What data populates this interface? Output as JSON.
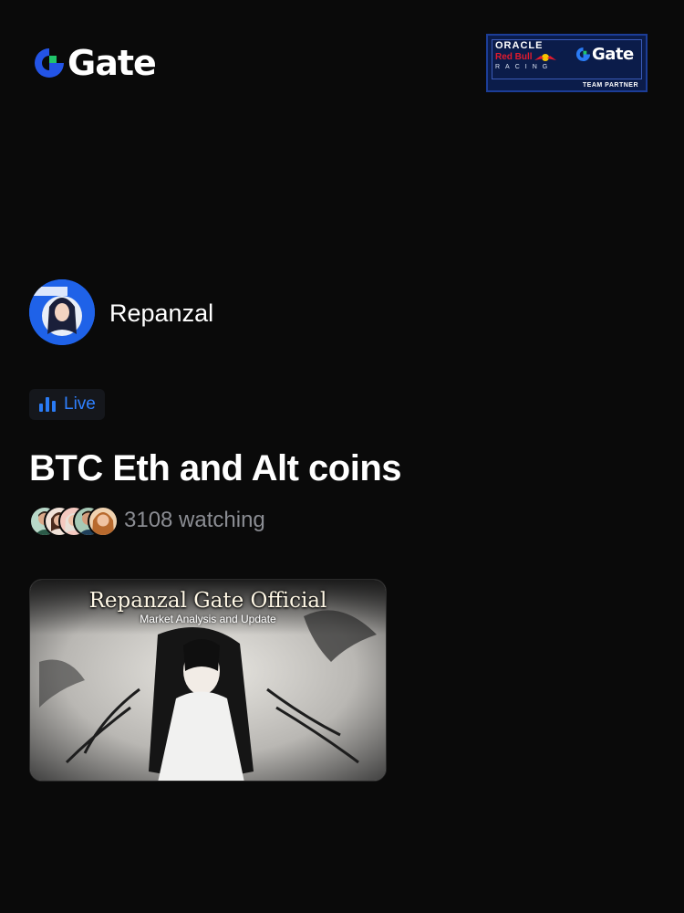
{
  "brand": {
    "logo_text": "Gate",
    "logo_icon": "gate-logo-icon",
    "accent": "#2354e6",
    "accent_green": "#20c46b"
  },
  "partner_badge": {
    "oracle": "ORACLE",
    "red_bull": "Red Bull",
    "racing": "RACING",
    "gate": "Gate",
    "team_partner": "TEAM PARTNER"
  },
  "stream": {
    "streamer_name": "Repanzal",
    "live_label": "Live",
    "live_icon": "bar-chart-icon",
    "live_color": "#2f80ff",
    "title": "BTC Eth and Alt coins",
    "watching": "3108 watching",
    "thumbnail_title": "Repanzal Gate Official",
    "thumbnail_subtitle": "Market Analysis and Update"
  }
}
